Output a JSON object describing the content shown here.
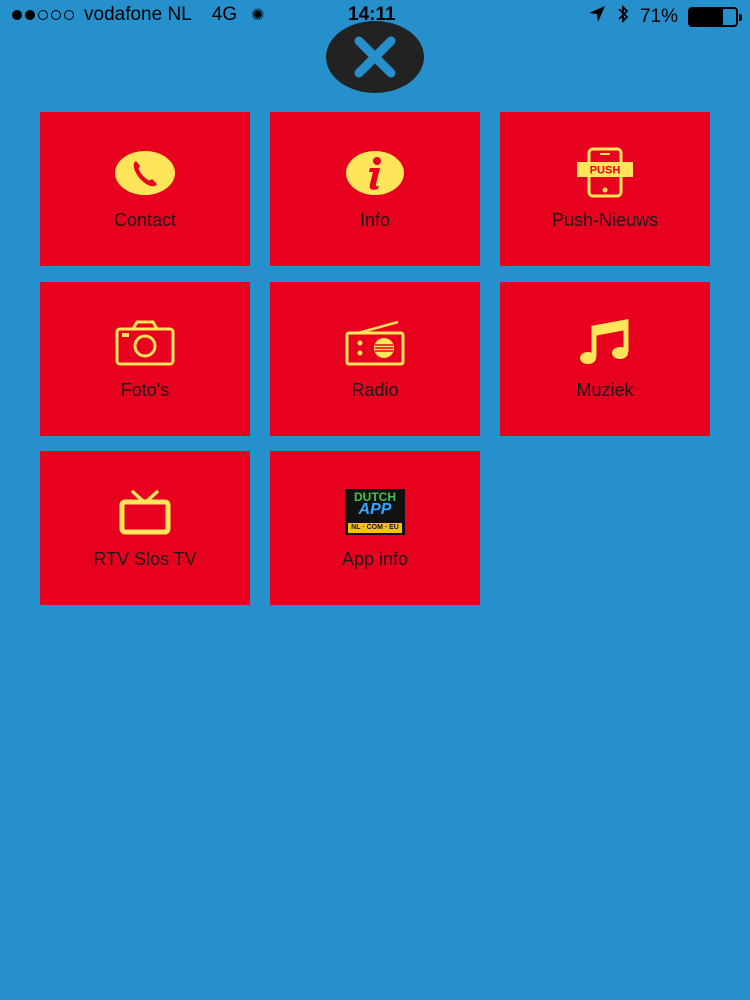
{
  "status_bar": {
    "carrier": "vodafone NL",
    "network": "4G",
    "time": "14:11",
    "battery_percent": "71%",
    "battery_level": 0.71,
    "signal_bars_filled": 2,
    "signal_bars_total": 5
  },
  "menu": {
    "close_icon": "close-x-icon",
    "accent_colors": {
      "background": "#2590cc",
      "tile": "#e8001f",
      "icon": "#ffe55a"
    },
    "tiles": [
      {
        "label": "Contact",
        "icon": "phone-icon"
      },
      {
        "label": "Info",
        "icon": "info-icon"
      },
      {
        "label": "Push-Nieuws",
        "icon": "push-phone-icon",
        "badge": "PUSH"
      },
      {
        "label": "Foto's",
        "icon": "camera-icon"
      },
      {
        "label": "Radio",
        "icon": "radio-icon"
      },
      {
        "label": "Muziek",
        "icon": "music-note-icon"
      },
      {
        "label": "RTV Slos TV",
        "icon": "tv-icon"
      },
      {
        "label": "App info",
        "icon": "dutch-app-logo",
        "logo": {
          "line1": "DUTCH",
          "line2": "APP",
          "line3": "NL · COM · EU"
        }
      }
    ]
  }
}
